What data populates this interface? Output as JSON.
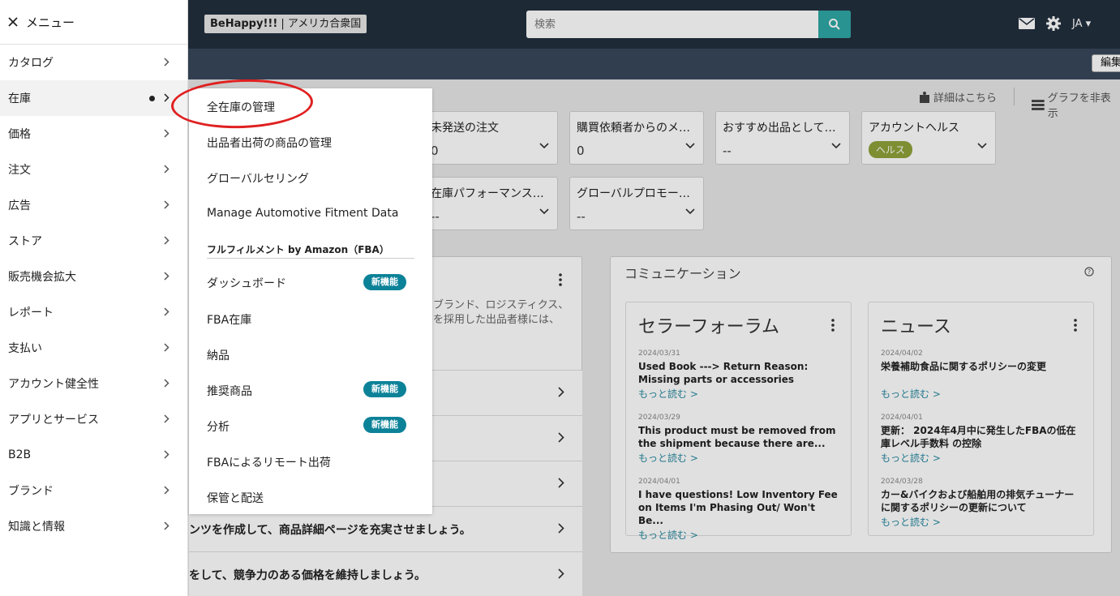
{
  "header": {
    "store_badge_bold": "BeHappy!!!",
    "store_badge_rest": " | アメリカ合衆国",
    "search_placeholder": "検索",
    "lang": "JA",
    "edit_label": "編集"
  },
  "tools": {
    "details": "詳細はこちら",
    "hide_graph": "グラフを非表示"
  },
  "cards": [
    {
      "title": "未発送の注文",
      "value": "0"
    },
    {
      "title": "購買依頼者からのメ…",
      "value": "0"
    },
    {
      "title": "おすすめ出品として…",
      "value": "--"
    },
    {
      "title": "アカウントヘルス",
      "value": "ヘルス"
    },
    {
      "title": "在庫パフォーマンス…",
      "value": "--"
    },
    {
      "title": "グローバルプロモー…",
      "value": "--"
    }
  ],
  "left_panel": {
    "text": "ブランド、ロジスティクス、を採用した出品者様には、",
    "rows": [
      "",
      "",
      "",
      "ンツを作成して、商品詳細ページを充実させましょう。",
      "をして、競争力のある価格を維持しましょう。"
    ]
  },
  "communication": {
    "title": "コミュニケーション",
    "forum": {
      "title": "セラーフォーラム",
      "posts": [
        {
          "date": "2024/03/31",
          "title": "Used Book ---> Return Reason: Missing parts or accessories",
          "more": "もっと読む >"
        },
        {
          "date": "2024/03/29",
          "title": "This product must be removed from the shipment because there are...",
          "more": "もっと読む >"
        },
        {
          "date": "2024/04/01",
          "title": "I have questions! Low Inventory Fee on Items I'm Phasing Out/ Won't Be...",
          "more": "もっと読む >"
        }
      ]
    },
    "news": {
      "title": "ニュース",
      "posts": [
        {
          "date": "2024/04/02",
          "title": "栄養補助食品に関するポリシーの変更",
          "more": "もっと読む >"
        },
        {
          "date": "2024/04/01",
          "title": "更新： 2024年4月中に発生したFBAの低在庫レベル手数料 の控除",
          "more": "もっと読む >"
        },
        {
          "date": "2024/03/28",
          "title": "カー&バイクおよび船舶用の排気チューナーに関するポリシーの更新について",
          "more": "もっと読む >"
        }
      ]
    }
  },
  "menu": {
    "title": "メニュー",
    "items": [
      "カタログ",
      "在庫",
      "価格",
      "注文",
      "広告",
      "ストア",
      "販売機会拡大",
      "レポート",
      "支払い",
      "アカウント健全性",
      "アプリとサービス",
      "B2B",
      "ブランド",
      "知識と情報"
    ]
  },
  "submenu": {
    "items": [
      "全在庫の管理",
      "出品者出荷の商品の管理",
      "グローバルセリング",
      "Manage Automotive Fitment Data"
    ],
    "section_title": "フルフィルメント by Amazon（FBA）",
    "fba_items": [
      "ダッシュボード",
      "FBA在庫",
      "納品",
      "推奨商品",
      "分析",
      "FBAによるリモート出荷",
      "保管と配送"
    ],
    "new_badge": "新機能"
  },
  "colors": {
    "topbar": "#232f3e",
    "subbar": "#37475a",
    "accent": "#0c8298",
    "highlight": "#e02020"
  }
}
